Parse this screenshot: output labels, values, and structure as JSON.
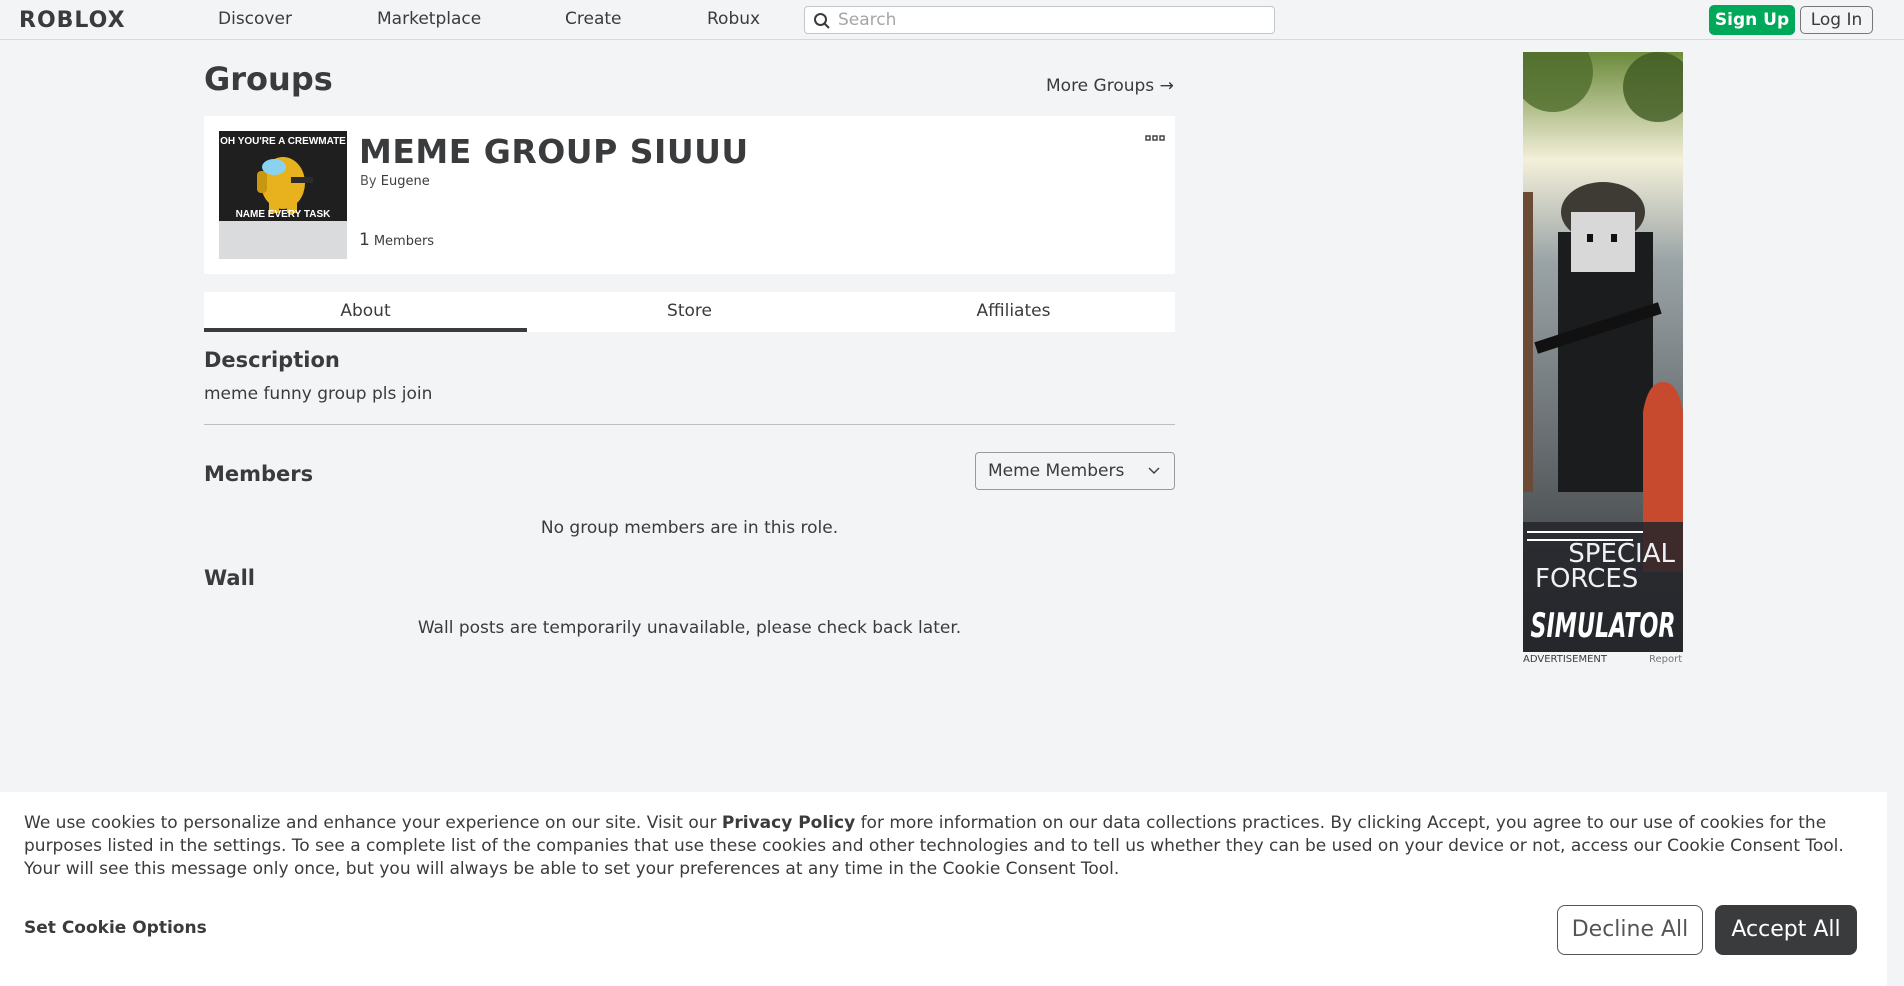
{
  "header": {
    "logo": "ROBLOX",
    "nav": [
      "Discover",
      "Marketplace",
      "Create",
      "Robux"
    ],
    "search_placeholder": "Search",
    "signup_label": "Sign Up",
    "login_label": "Log In"
  },
  "page": {
    "title": "Groups",
    "more_groups": "More Groups →"
  },
  "group": {
    "name": "MEME GROUP SIUUU",
    "by_label": "By",
    "owner": "Eugene",
    "member_count": "1",
    "members_label": "Members",
    "thumb_top_text": "OH YOU'RE A CREWMATE",
    "thumb_bottom_text": "NAME EVERY TASK"
  },
  "tabs": [
    "About",
    "Store",
    "Affiliates"
  ],
  "about": {
    "description_heading": "Description",
    "description_text": "meme funny group pls join",
    "members_heading": "Members",
    "role_selected": "Meme Members",
    "members_empty": "No group members are in this role.",
    "wall_heading": "Wall",
    "wall_empty": "Wall posts are temporarily unavailable, please check back later."
  },
  "ad": {
    "title_line1": "SPECIAL",
    "title_line2": "FORCES",
    "title_line3": "SIMULATOR",
    "caption": "ADVERTISEMENT",
    "report": "Report"
  },
  "cookie": {
    "text_before": "We use cookies to personalize and enhance your experience on our site. Visit our ",
    "privacy_link": "Privacy Policy",
    "text_after": " for more information on our data collections practices. By clicking Accept, you agree to our use of cookies for the purposes listed in the settings. To see a complete list of the companies that use these cookies and other technologies and to tell us whether they can be used on your device or not, access our Cookie Consent Tool. Your will see this message only once, but you will always be able to set your preferences at any time in the Cookie Consent Tool.",
    "set_options": "Set Cookie Options",
    "decline": "Decline All",
    "accept": "Accept All"
  },
  "colors": {
    "signup_green": "#00a85a",
    "accept_dark": "#393b3d",
    "page_bg": "#f2f4f5"
  }
}
